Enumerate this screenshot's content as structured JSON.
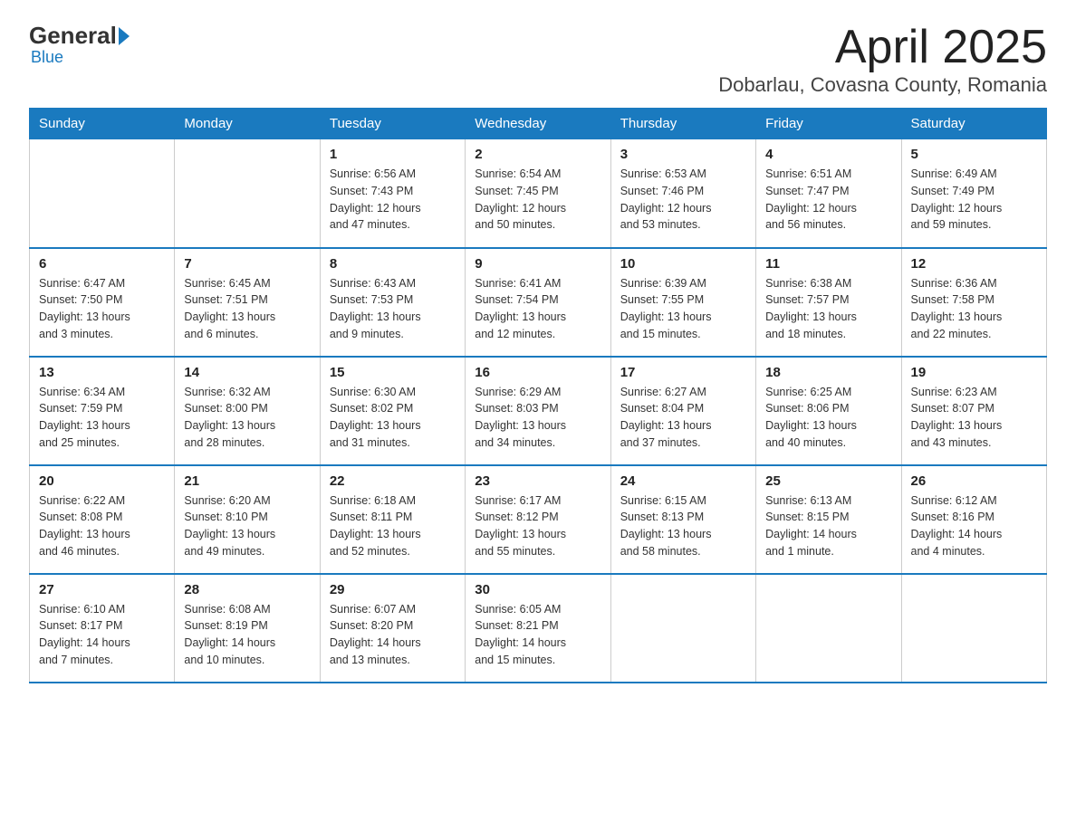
{
  "header": {
    "logo_main": "General",
    "logo_accent": "Blue",
    "title": "April 2025",
    "subtitle": "Dobarlau, Covasna County, Romania"
  },
  "weekdays": [
    "Sunday",
    "Monday",
    "Tuesday",
    "Wednesday",
    "Thursday",
    "Friday",
    "Saturday"
  ],
  "weeks": [
    [
      {
        "day": "",
        "info": ""
      },
      {
        "day": "",
        "info": ""
      },
      {
        "day": "1",
        "info": "Sunrise: 6:56 AM\nSunset: 7:43 PM\nDaylight: 12 hours\nand 47 minutes."
      },
      {
        "day": "2",
        "info": "Sunrise: 6:54 AM\nSunset: 7:45 PM\nDaylight: 12 hours\nand 50 minutes."
      },
      {
        "day": "3",
        "info": "Sunrise: 6:53 AM\nSunset: 7:46 PM\nDaylight: 12 hours\nand 53 minutes."
      },
      {
        "day": "4",
        "info": "Sunrise: 6:51 AM\nSunset: 7:47 PM\nDaylight: 12 hours\nand 56 minutes."
      },
      {
        "day": "5",
        "info": "Sunrise: 6:49 AM\nSunset: 7:49 PM\nDaylight: 12 hours\nand 59 minutes."
      }
    ],
    [
      {
        "day": "6",
        "info": "Sunrise: 6:47 AM\nSunset: 7:50 PM\nDaylight: 13 hours\nand 3 minutes."
      },
      {
        "day": "7",
        "info": "Sunrise: 6:45 AM\nSunset: 7:51 PM\nDaylight: 13 hours\nand 6 minutes."
      },
      {
        "day": "8",
        "info": "Sunrise: 6:43 AM\nSunset: 7:53 PM\nDaylight: 13 hours\nand 9 minutes."
      },
      {
        "day": "9",
        "info": "Sunrise: 6:41 AM\nSunset: 7:54 PM\nDaylight: 13 hours\nand 12 minutes."
      },
      {
        "day": "10",
        "info": "Sunrise: 6:39 AM\nSunset: 7:55 PM\nDaylight: 13 hours\nand 15 minutes."
      },
      {
        "day": "11",
        "info": "Sunrise: 6:38 AM\nSunset: 7:57 PM\nDaylight: 13 hours\nand 18 minutes."
      },
      {
        "day": "12",
        "info": "Sunrise: 6:36 AM\nSunset: 7:58 PM\nDaylight: 13 hours\nand 22 minutes."
      }
    ],
    [
      {
        "day": "13",
        "info": "Sunrise: 6:34 AM\nSunset: 7:59 PM\nDaylight: 13 hours\nand 25 minutes."
      },
      {
        "day": "14",
        "info": "Sunrise: 6:32 AM\nSunset: 8:00 PM\nDaylight: 13 hours\nand 28 minutes."
      },
      {
        "day": "15",
        "info": "Sunrise: 6:30 AM\nSunset: 8:02 PM\nDaylight: 13 hours\nand 31 minutes."
      },
      {
        "day": "16",
        "info": "Sunrise: 6:29 AM\nSunset: 8:03 PM\nDaylight: 13 hours\nand 34 minutes."
      },
      {
        "day": "17",
        "info": "Sunrise: 6:27 AM\nSunset: 8:04 PM\nDaylight: 13 hours\nand 37 minutes."
      },
      {
        "day": "18",
        "info": "Sunrise: 6:25 AM\nSunset: 8:06 PM\nDaylight: 13 hours\nand 40 minutes."
      },
      {
        "day": "19",
        "info": "Sunrise: 6:23 AM\nSunset: 8:07 PM\nDaylight: 13 hours\nand 43 minutes."
      }
    ],
    [
      {
        "day": "20",
        "info": "Sunrise: 6:22 AM\nSunset: 8:08 PM\nDaylight: 13 hours\nand 46 minutes."
      },
      {
        "day": "21",
        "info": "Sunrise: 6:20 AM\nSunset: 8:10 PM\nDaylight: 13 hours\nand 49 minutes."
      },
      {
        "day": "22",
        "info": "Sunrise: 6:18 AM\nSunset: 8:11 PM\nDaylight: 13 hours\nand 52 minutes."
      },
      {
        "day": "23",
        "info": "Sunrise: 6:17 AM\nSunset: 8:12 PM\nDaylight: 13 hours\nand 55 minutes."
      },
      {
        "day": "24",
        "info": "Sunrise: 6:15 AM\nSunset: 8:13 PM\nDaylight: 13 hours\nand 58 minutes."
      },
      {
        "day": "25",
        "info": "Sunrise: 6:13 AM\nSunset: 8:15 PM\nDaylight: 14 hours\nand 1 minute."
      },
      {
        "day": "26",
        "info": "Sunrise: 6:12 AM\nSunset: 8:16 PM\nDaylight: 14 hours\nand 4 minutes."
      }
    ],
    [
      {
        "day": "27",
        "info": "Sunrise: 6:10 AM\nSunset: 8:17 PM\nDaylight: 14 hours\nand 7 minutes."
      },
      {
        "day": "28",
        "info": "Sunrise: 6:08 AM\nSunset: 8:19 PM\nDaylight: 14 hours\nand 10 minutes."
      },
      {
        "day": "29",
        "info": "Sunrise: 6:07 AM\nSunset: 8:20 PM\nDaylight: 14 hours\nand 13 minutes."
      },
      {
        "day": "30",
        "info": "Sunrise: 6:05 AM\nSunset: 8:21 PM\nDaylight: 14 hours\nand 15 minutes."
      },
      {
        "day": "",
        "info": ""
      },
      {
        "day": "",
        "info": ""
      },
      {
        "day": "",
        "info": ""
      }
    ]
  ]
}
